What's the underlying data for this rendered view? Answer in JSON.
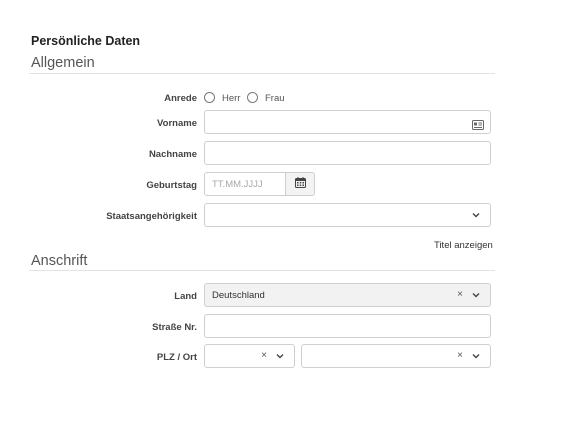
{
  "form": {
    "title": "Persönliche Daten"
  },
  "general": {
    "heading": "Allgemein",
    "salutation": {
      "label": "Anrede",
      "options": [
        "Herr",
        "Frau"
      ],
      "selected": null
    },
    "first_name": {
      "label": "Vorname",
      "value": "",
      "icon": "contact-card-icon"
    },
    "last_name": {
      "label": "Nachname",
      "value": ""
    },
    "birthday": {
      "label": "Geburtstag",
      "placeholder": "TT.MM.JJJJ",
      "icon": "calendar-icon"
    },
    "nationality": {
      "label": "Staatsangehörigkeit",
      "value": ""
    },
    "show_title_link": "Titel anzeigen"
  },
  "address": {
    "heading": "Anschrift",
    "country": {
      "label": "Land",
      "value": "Deutschland"
    },
    "street": {
      "label": "Straße Nr.",
      "value": ""
    },
    "zip_city": {
      "label": "PLZ / Ort",
      "zip_value": "",
      "city_value": ""
    }
  }
}
